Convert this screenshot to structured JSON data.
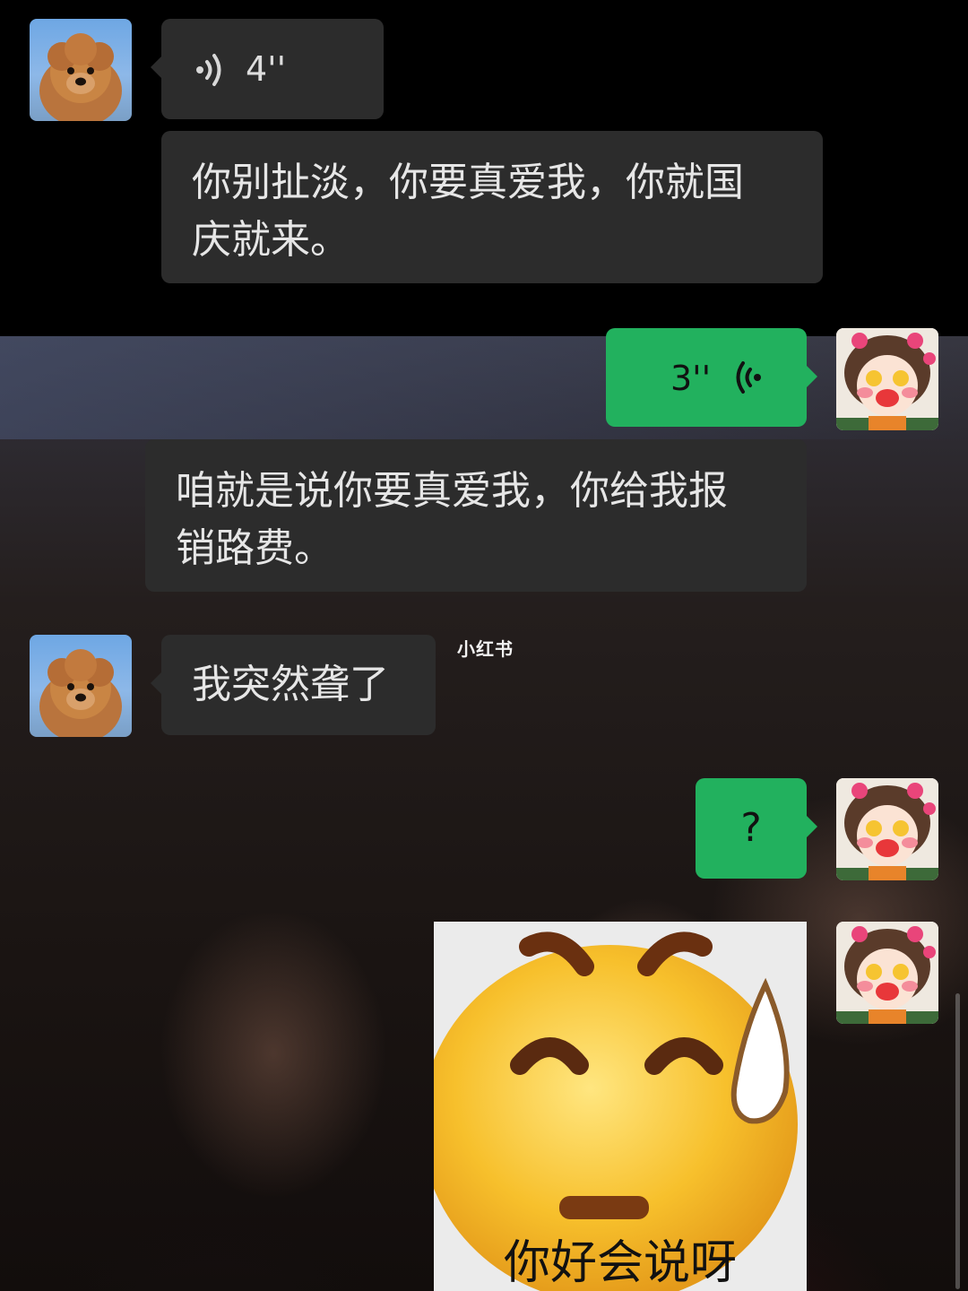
{
  "messages": [
    {
      "side": "left",
      "type": "voice",
      "duration": "4''"
    },
    {
      "side": "left",
      "type": "text",
      "lines": [
        "你别扯淡，你要真爱我，你就国",
        "庆就来。"
      ]
    },
    {
      "side": "right",
      "type": "voice",
      "duration": "3''"
    },
    {
      "side": "right",
      "type": "text",
      "lines": [
        "咱就是说你要真爱我，你给我报",
        "销路费。"
      ]
    },
    {
      "side": "left",
      "type": "text",
      "lines": [
        "我突然聋了"
      ]
    },
    {
      "side": "right",
      "type": "text",
      "lines": [
        "?"
      ]
    },
    {
      "side": "right",
      "type": "sticker",
      "caption": "你好会说呀"
    }
  ],
  "watermark": "小红书",
  "colors": {
    "background": "#000000",
    "bubble_dark": "#2c2c2c",
    "bubble_green": "#22b15e",
    "text": "#e6e6e6"
  },
  "icons": {
    "left_avatar": "dog-avatar",
    "right_avatar": "cartoon-girl-avatar",
    "voice": "sound-wave-icon",
    "sticker_face": "sweating-emoji-face"
  }
}
